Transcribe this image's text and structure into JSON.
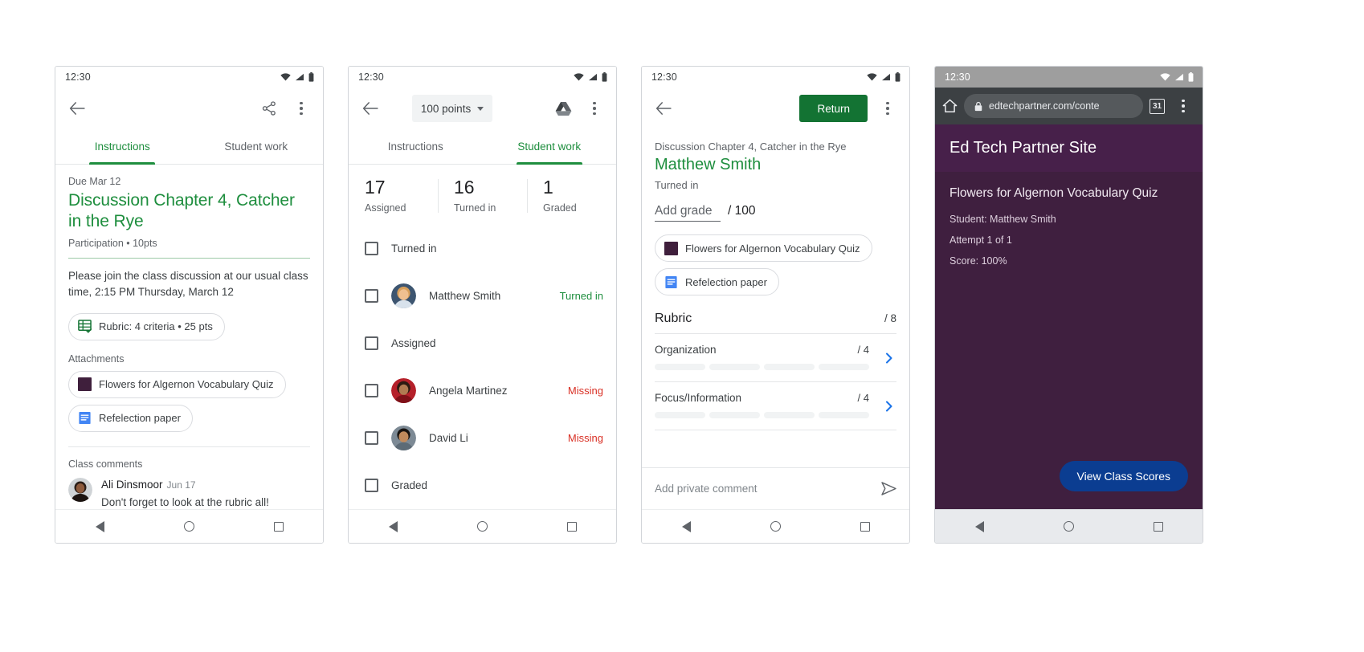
{
  "panel1": {
    "statusbar": {
      "time": "12:30"
    },
    "appbar": {
      "back": "back-arrow",
      "share": "share",
      "more": "more-options"
    },
    "tabs": [
      {
        "label": "Instructions",
        "active": true
      },
      {
        "label": "Student work",
        "active": false
      }
    ],
    "due": "Due Mar 12",
    "title": "Discussion Chapter 4, Catcher in the Rye",
    "subinfo": "Participation • 10pts",
    "description": "Please join the class discussion at our usual class time, 2:15 PM Thursday, March 12",
    "rubric_chip": "Rubric: 4 criteria • 25 pts",
    "attachments_label": "Attachments",
    "attachments": [
      {
        "label": "Flowers for Algernon Vocabulary Quiz",
        "icon": "purple-swatch-icon"
      },
      {
        "label": "Refelection paper",
        "icon": "google-docs-icon"
      }
    ],
    "comments_label": "Class comments",
    "comment": {
      "author": "Ali Dinsmoor",
      "date": "Jun 17",
      "text": "Don't forget to look at the rubric all!"
    }
  },
  "panel2": {
    "statusbar": {
      "time": "12:30"
    },
    "points_label": "100 points",
    "tabs": [
      {
        "label": "Instructions",
        "active": false
      },
      {
        "label": "Student work",
        "active": true
      }
    ],
    "stats": [
      {
        "num": "17",
        "label": "Assigned"
      },
      {
        "num": "16",
        "label": "Turned in"
      },
      {
        "num": "1",
        "label": "Graded"
      }
    ],
    "rows": [
      {
        "type": "group",
        "label": "Turned in"
      },
      {
        "type": "student",
        "name": "Matthew Smith",
        "status": "Turned in",
        "status_kind": "turned"
      },
      {
        "type": "group",
        "label": "Assigned"
      },
      {
        "type": "student",
        "name": "Angela Martinez",
        "status": "Missing",
        "status_kind": "missing"
      },
      {
        "type": "student",
        "name": "David Li",
        "status": "Missing",
        "status_kind": "missing"
      },
      {
        "type": "group",
        "label": "Graded"
      }
    ]
  },
  "panel3": {
    "statusbar": {
      "time": "12:30"
    },
    "return_label": "Return",
    "assignment": "Discussion Chapter 4, Catcher in the Rye",
    "student": "Matthew Smith",
    "state": "Turned in",
    "grade_placeholder": "Add grade",
    "grade_max": "/ 100",
    "attachments": [
      {
        "label": "Flowers for Algernon Vocabulary Quiz",
        "icon": "purple-swatch-icon"
      },
      {
        "label": "Refelection paper",
        "icon": "google-docs-icon"
      }
    ],
    "rubric": {
      "title": "Rubric",
      "total": "/ 8",
      "criteria": [
        {
          "name": "Organization",
          "points": "/ 4",
          "levels": 4
        },
        {
          "name": "Focus/Information",
          "points": "/ 4",
          "levels": 4
        }
      ]
    },
    "private_comment_placeholder": "Add private comment"
  },
  "panel4": {
    "statusbar": {
      "time": "12:30"
    },
    "browser": {
      "url": "edtechpartner.com/conte",
      "tab_count": "31",
      "home": "home-icon",
      "lock": "lock-icon"
    },
    "site_title": "Ed Tech Partner Site",
    "quiz_title": "Flowers for Algernon Vocabulary Quiz",
    "lines": [
      "Student: Matthew Smith",
      "Attempt 1 of 1",
      "Score: 100%"
    ],
    "cta": "View Class Scores",
    "colors": {
      "header": "#47204a",
      "body": "#3f1f3f",
      "cta": "#0b3d91"
    }
  },
  "colors": {
    "green": "#1e8e3e",
    "green_dark": "#137333",
    "red": "#d93025",
    "grey_text": "#5f6368"
  }
}
